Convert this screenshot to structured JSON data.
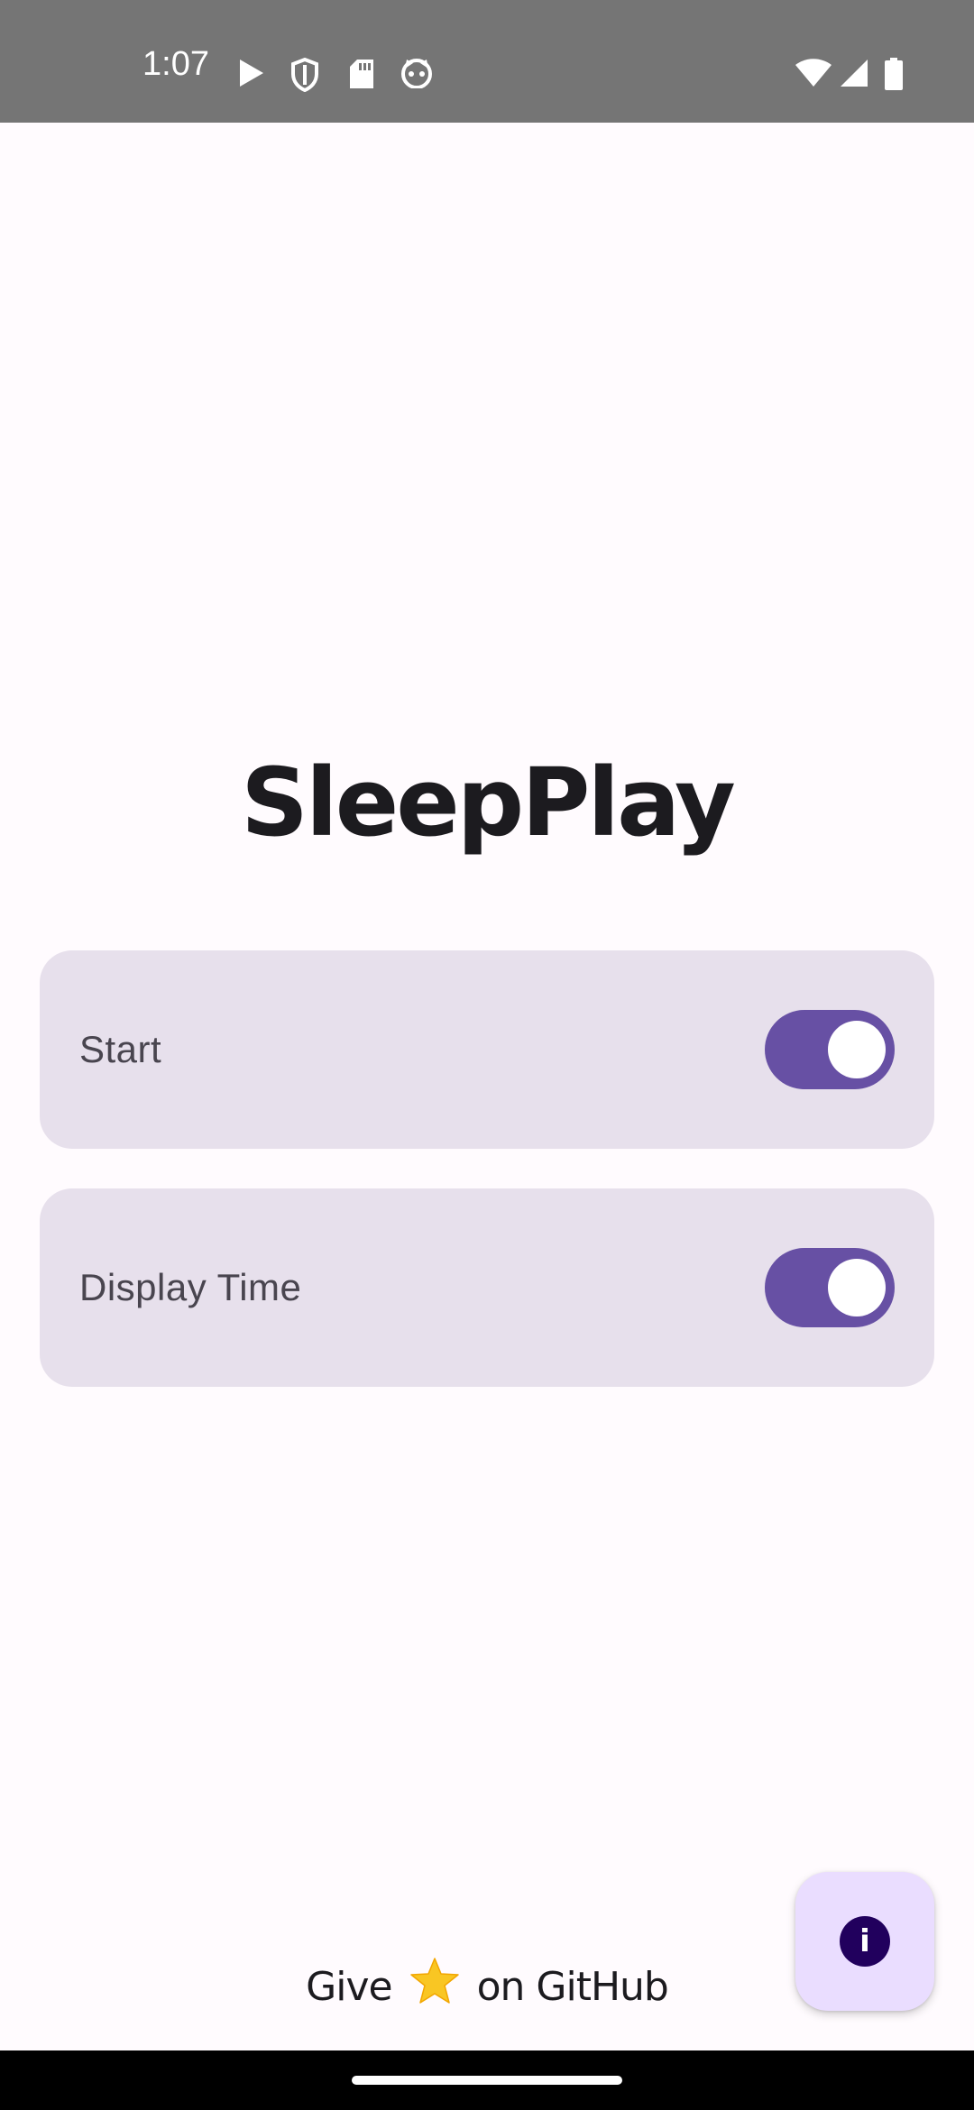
{
  "status_bar": {
    "time": "1:07",
    "left_icons": [
      "play-icon",
      "shield-icon",
      "sd-card-icon",
      "cat-face-icon"
    ],
    "right_icons": [
      "wifi-icon",
      "signal-icon",
      "battery-icon"
    ]
  },
  "app": {
    "title": "SleepPlay"
  },
  "settings": [
    {
      "label": "Start",
      "enabled": true
    },
    {
      "label": "Display Time",
      "enabled": true
    }
  ],
  "fab": {
    "icon": "info-icon",
    "glyph": "i"
  },
  "footer": {
    "github_prefix": "Give",
    "github_star": "⭐",
    "github_suffix": "on GitHub"
  },
  "colors": {
    "background": "#FFFBFE",
    "status_bar": "#757575",
    "card": "#E7E0EC",
    "switch_track": "#6750A4",
    "fab": "#EADDFF",
    "fab_icon": "#21005D",
    "star": "#F9C623"
  }
}
